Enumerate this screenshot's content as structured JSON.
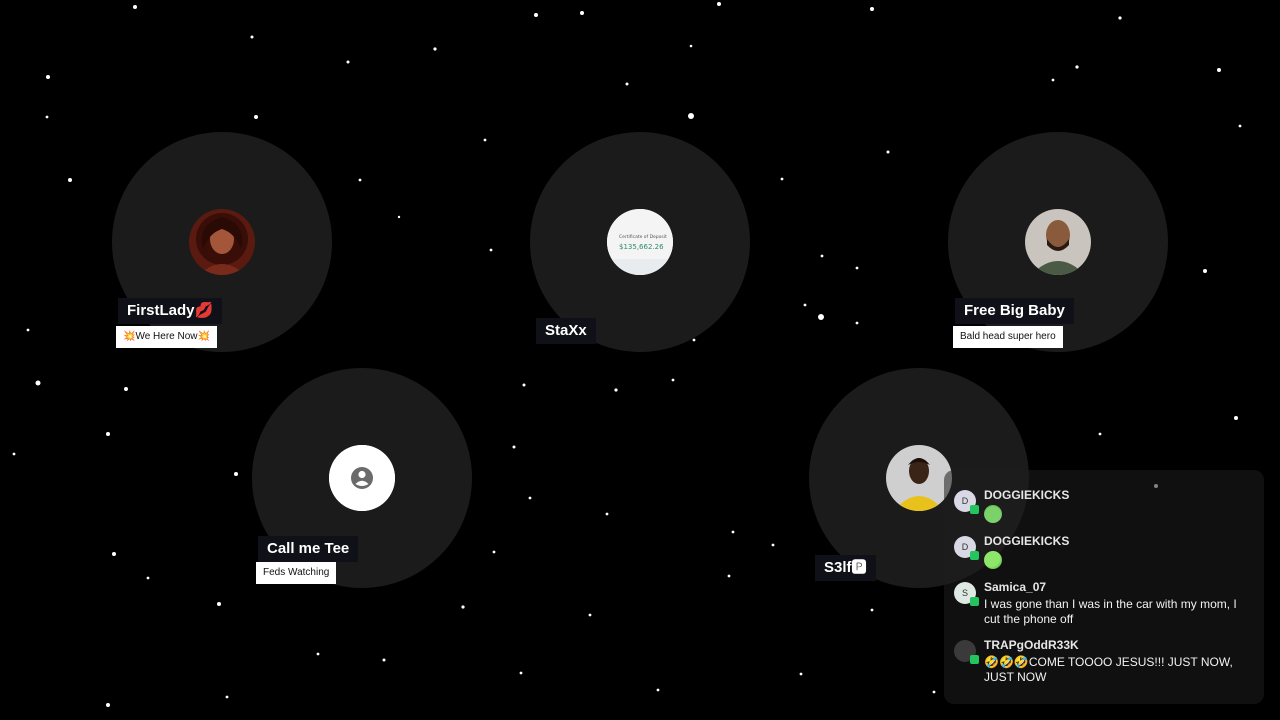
{
  "seats": [
    {
      "name": "FirstLady💋",
      "status": "💥We Here Now💥",
      "avatar_icon": "portrait-woman"
    },
    {
      "name": "StaXx",
      "status": "",
      "avatar_icon": "certificate-of-deposit"
    },
    {
      "name": "Free Big Baby",
      "status": "Bald head super hero",
      "avatar_icon": "portrait-man"
    },
    {
      "name": "Call me Tee",
      "status": "Feds Watching",
      "avatar_icon": "default-user-icon"
    },
    {
      "name": "S3lf🅿",
      "status": "",
      "avatar_icon": "portrait-yellow-shirt"
    }
  ],
  "avatar_texts": {
    "certificate_title": "Certificate of Deposit",
    "certificate_amount": "$135,662.26"
  },
  "chat": {
    "messages": [
      {
        "initial": "D",
        "user": "DOGGIEKICKS",
        "text": "",
        "emoji": "green-face-emoji"
      },
      {
        "initial": "D",
        "user": "DOGGIEKICKS",
        "text": "",
        "emoji": "green-face-emoji"
      },
      {
        "initial": "S",
        "user": "Samica_07",
        "text": "I was gone than I was in the car with my mom, I cut the phone off"
      },
      {
        "initial": "",
        "user": "TRAPgOddR33K",
        "text": "🤣🤣🤣COME TOOOO JESUS!!! JUST NOW, JUST NOW"
      }
    ]
  },
  "colors": {
    "background": "#000000",
    "seat": "#1b1b1b",
    "badge": "#22c55e"
  }
}
